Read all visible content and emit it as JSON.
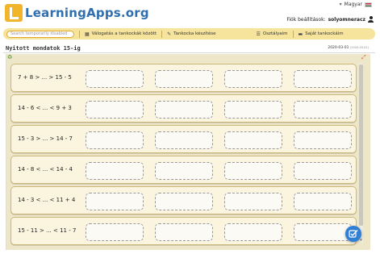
{
  "header": {
    "logo_text": "LearningApps.org",
    "language": "Magyar",
    "account_prefix": "Fiók beállítások:",
    "account_user": "solyomneracz"
  },
  "nav": {
    "search_placeholder": "Search temporarily disabled",
    "items": [
      {
        "label": "Válogatás a tankockák között",
        "icon": "grid-icon"
      },
      {
        "label": "Tankocka készítése",
        "icon": "pencil-icon"
      },
      {
        "label": "Osztályaim",
        "icon": "list-icon"
      },
      {
        "label": "Saját tankockáim",
        "icon": "folder-icon"
      }
    ]
  },
  "page": {
    "title": "Nyitott mondatok 15-ig",
    "date": "2020-03-01",
    "date_small": "(2020-03-01)"
  },
  "exercise": {
    "rows": [
      {
        "expression": "7 + 8 > ... > 15 - 5"
      },
      {
        "expression": "14 - 6 < ... < 9 + 3"
      },
      {
        "expression": "15 - 3 > ... > 14 - 7"
      },
      {
        "expression": "14 - 8 < ... < 14 - 4"
      },
      {
        "expression": "14 - 3 < ... < 11 + 4"
      },
      {
        "expression": "15 - 11 > ... < 11 - 7"
      }
    ],
    "slots_per_row": 4
  },
  "colors": {
    "logo": "#2f6fb0",
    "navbar": "#f6e49c",
    "frame": "#eee6c9",
    "row": "#fbf5df",
    "fab": "#2f7fd4"
  }
}
